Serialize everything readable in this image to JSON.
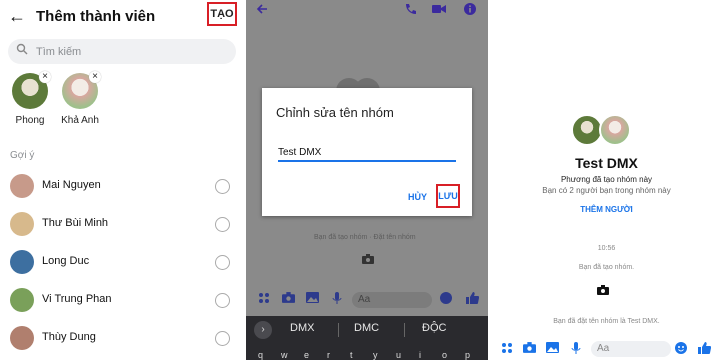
{
  "panel1": {
    "back_glyph": "←",
    "title": "Thêm thành viên",
    "create_label": "TẠO",
    "search": {
      "placeholder": "Tìm kiếm"
    },
    "selected": [
      {
        "name": "Phong",
        "color": "#5d7a3a"
      },
      {
        "name": "Khả Anh",
        "color": "#d9a7a0"
      }
    ],
    "remove_glyph": "×",
    "section_label": "Gợi ý",
    "suggestions": [
      {
        "name": "Mai Nguyen",
        "color": "#c79a8a"
      },
      {
        "name": "Thư Bùi Minh",
        "color": "#d7b98c"
      },
      {
        "name": "Long Duc",
        "color": "#3d6fa0"
      },
      {
        "name": "Vi Trung Phan",
        "color": "#7aa05a"
      },
      {
        "name": "Thùy Dung",
        "color": "#b07f6e"
      }
    ]
  },
  "panel2": {
    "dialog": {
      "title": "Chỉnh sửa tên nhóm",
      "value": "Test DMX",
      "cancel_label": "HỦY",
      "save_label": "LƯU"
    },
    "bg_hint": "Bạn đã tạo nhóm · Đặt tên nhóm",
    "input_placeholder": "Aa",
    "keyboard_suggestions": [
      "DMX",
      "DMC",
      "ĐỘC"
    ],
    "keyboard_row": [
      "q",
      "w",
      "e",
      "r",
      "t",
      "y",
      "u",
      "i",
      "o",
      "p"
    ]
  },
  "panel3": {
    "group_name": "Test DMX",
    "created_text": "Phương đã tạo nhóm này",
    "members_text": "Bạn có 2 người bạn trong nhóm này",
    "add_people_label": "THÊM NGƯỜI",
    "time": "10:56",
    "you_created": "Bạn đã tạo nhóm.",
    "renamed_text": "Bạn đã đặt tên nhóm là Test DMX.",
    "input_placeholder": "Aa"
  },
  "colors": {
    "accent_blue": "#1a73e8",
    "highlight_red": "#d81f26",
    "messenger_purple": "#3b2a9e"
  }
}
